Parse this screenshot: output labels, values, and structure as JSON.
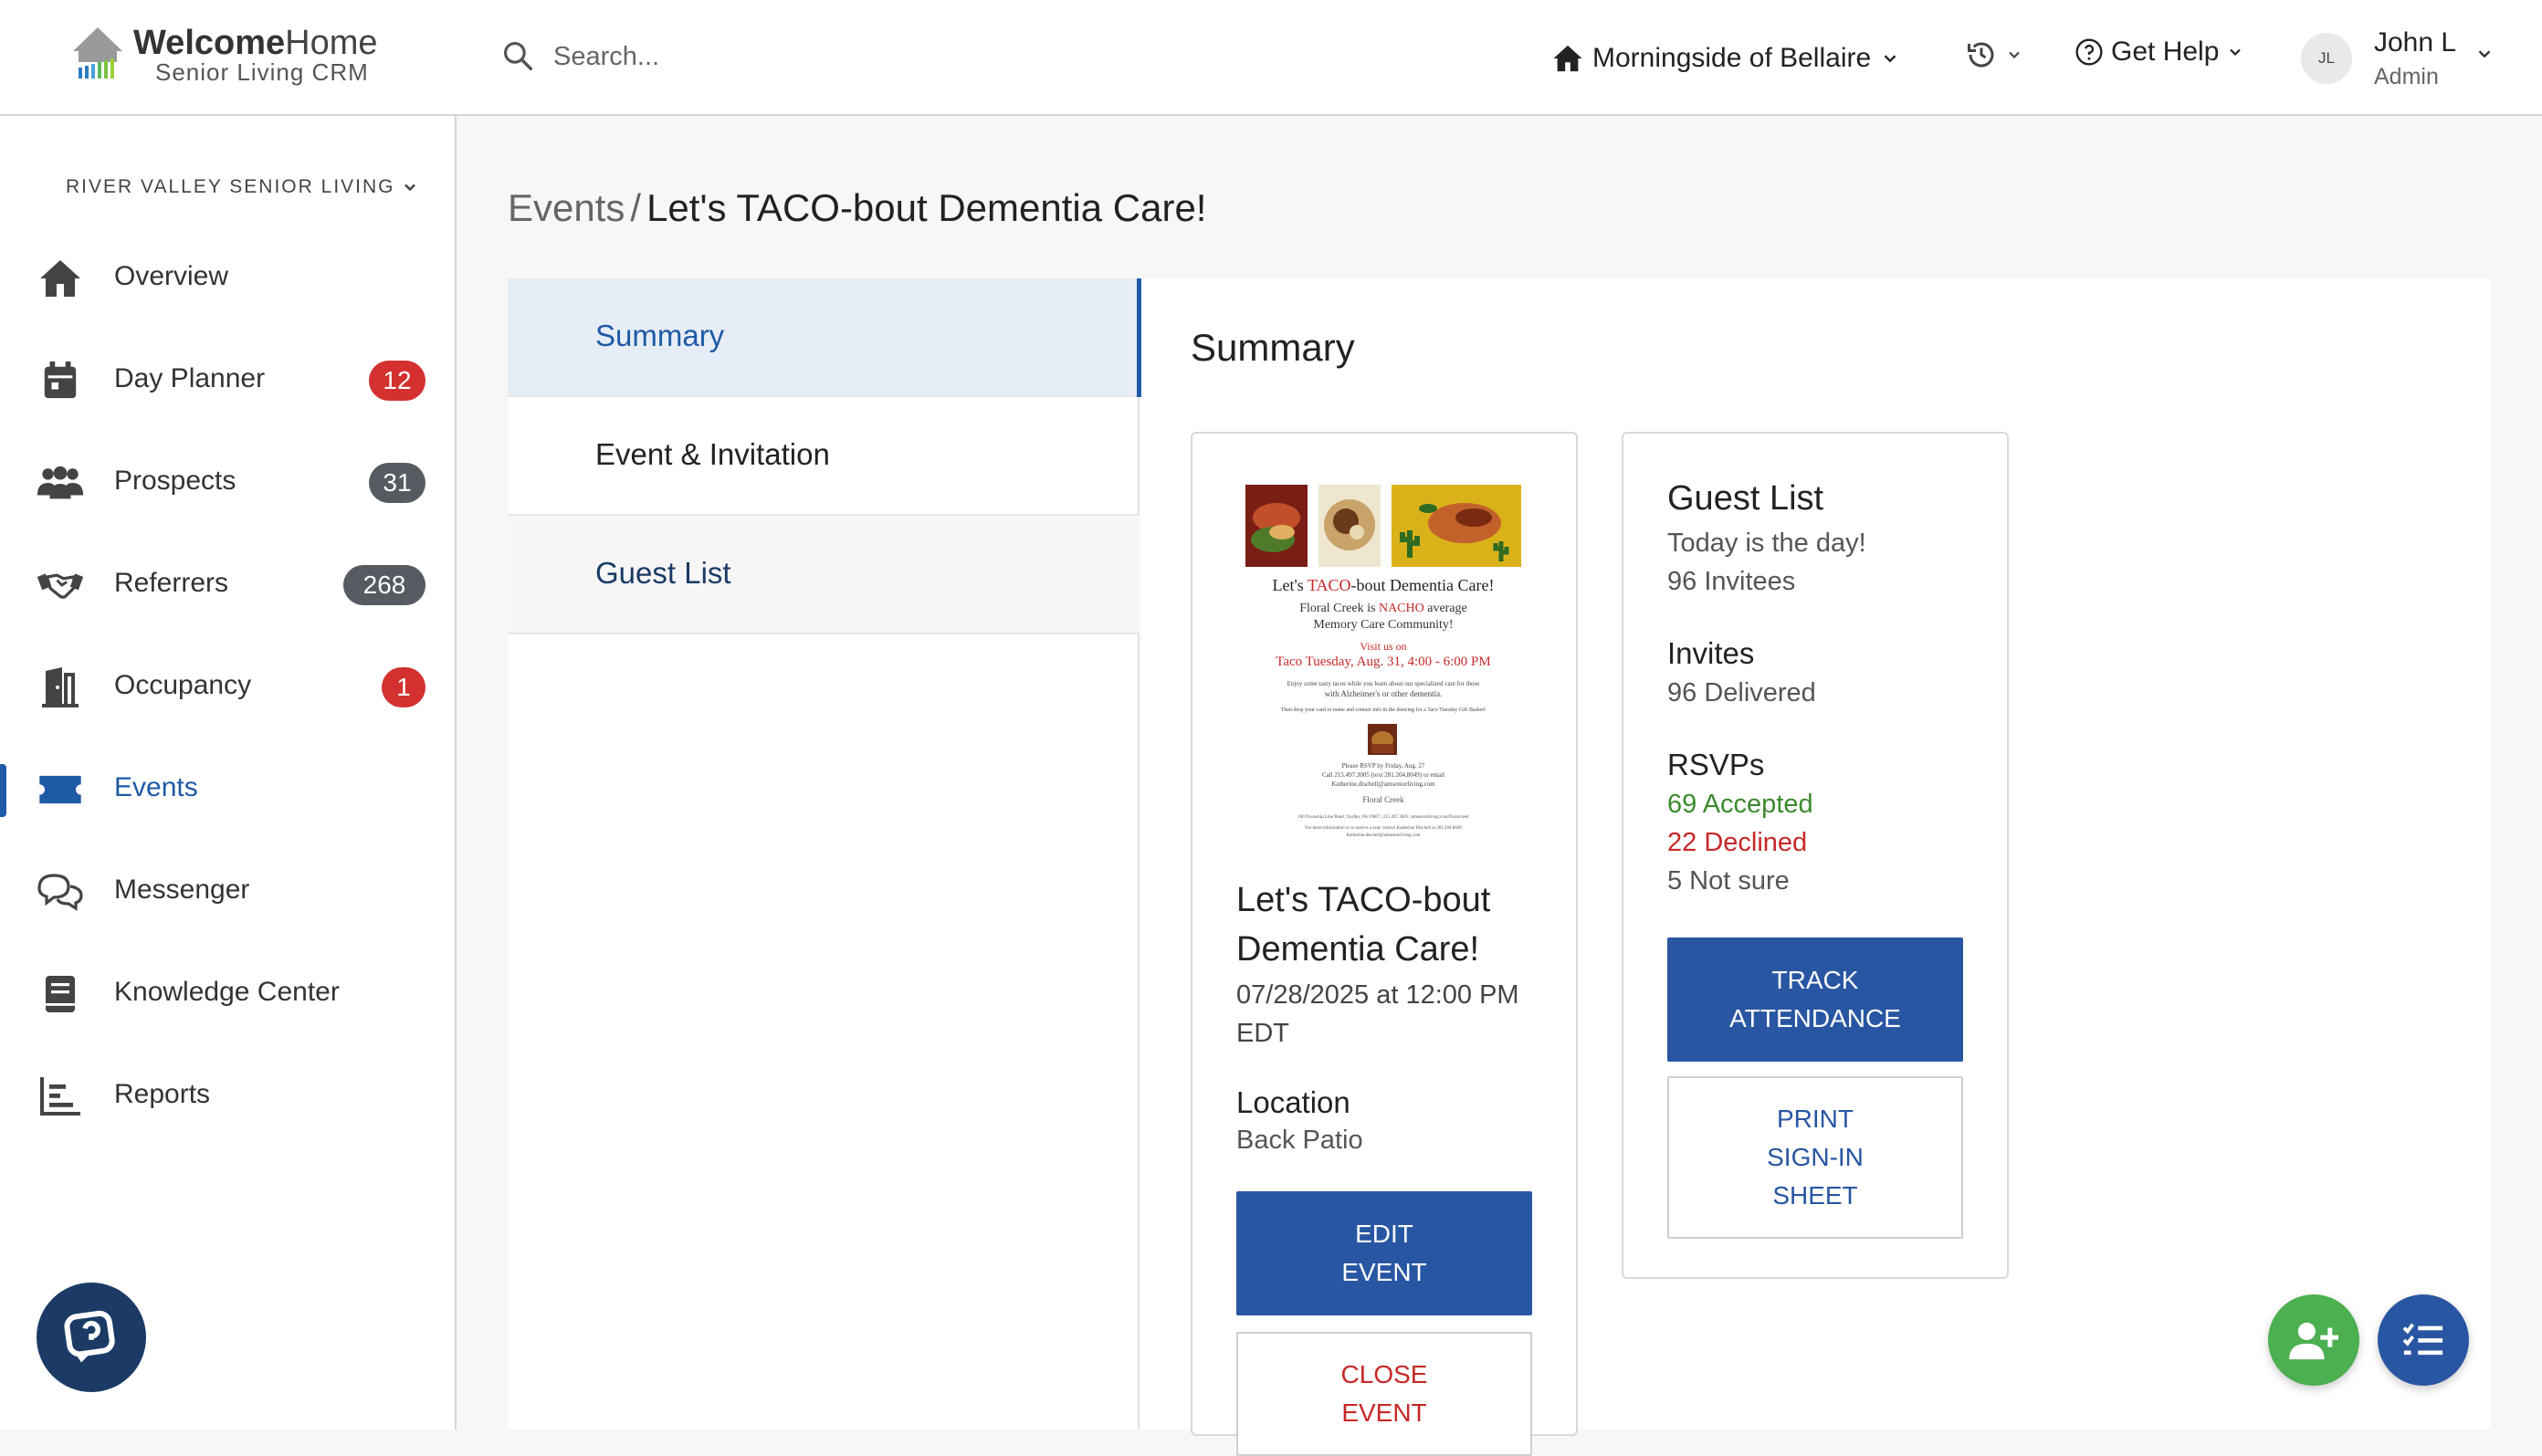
{
  "brand": {
    "title_bold": "Welcome",
    "title_rest": "Home",
    "subtitle": "Senior Living CRM"
  },
  "search": {
    "placeholder": "Search..."
  },
  "community": {
    "label": "Morningside of Bellaire"
  },
  "help": {
    "label": "Get Help"
  },
  "user": {
    "initials": "JL",
    "name": "John L",
    "role": "Admin"
  },
  "sidebar": {
    "org": "RIVER VALLEY SENIOR LIVING",
    "items": [
      {
        "label": "Overview",
        "icon": "home-icon"
      },
      {
        "label": "Day Planner",
        "icon": "calendar-icon",
        "badge": "12",
        "badge_color": "#d3302f"
      },
      {
        "label": "Prospects",
        "icon": "people-icon",
        "badge": "31",
        "badge_color": "#555b61"
      },
      {
        "label": "Referrers",
        "icon": "handshake-icon",
        "badge": "268",
        "badge_color": "#555b61"
      },
      {
        "label": "Occupancy",
        "icon": "door-icon",
        "badge": "1",
        "badge_color": "#d3302f"
      },
      {
        "label": "Events",
        "icon": "ticket-icon",
        "active": true
      },
      {
        "label": "Messenger",
        "icon": "chat-icon"
      },
      {
        "label": "Knowledge Center",
        "icon": "book-icon"
      },
      {
        "label": "Reports",
        "icon": "chart-icon"
      }
    ]
  },
  "breadcrumb": {
    "parent": "Events",
    "separator": "/",
    "current": "Let's TACO-bout Dementia Care!"
  },
  "tabs": [
    {
      "label": "Summary"
    },
    {
      "label": "Event & Invitation"
    },
    {
      "label": "Guest List"
    }
  ],
  "summary": {
    "title": "Summary",
    "flyer": {
      "headline_a": "Let's ",
      "headline_b": "TACO",
      "headline_c": "-bout Dementia Care!",
      "line1_a": "Floral Creek is ",
      "line1_b": "NACHO",
      "line1_c": " average",
      "line2": "Memory Care Community!",
      "line3": "Visit us on",
      "line4": "Taco Tuesday, Aug. 31, 4:00 - 6:00 PM",
      "line5": "Enjoy some tasty tacos while you learn about our specialized care for those",
      "line6": "with Alzheimer's or other dementia.",
      "line7": "Then drop your card or name and contact info in the drawing for a Taco Tuesday Gift Basket!",
      "line8": "Please RSVP by Friday, Aug. 27",
      "line9": "Call 215.497.3005 (text 281.204.8049) or email",
      "line10": "Katherine.dischell@amseniorliving.com",
      "line11": "Floral Creek",
      "line12": "100 Township Line Road, Yardley, PA 19067 | 215.497.3005 | amseniorliving.com/floralcreek",
      "line13": "For more information or to reserve a seat, contact Katherine Dischell at 281.204.8049",
      "line14": "Katherine.dischell@amseniorliving.com"
    },
    "event_name": "Let's TACO-bout Dementia Care!",
    "event_date": "07/28/2025 at 12:00 PM EDT",
    "location_heading": "Location",
    "location_value": "Back Patio",
    "edit_label": "EDIT EVENT",
    "close_label": "CLOSE EVENT",
    "guest_list": {
      "heading": "Guest List",
      "today": "Today is the day!",
      "invitees": "96 Invitees",
      "invites_heading": "Invites",
      "delivered": "96 Delivered",
      "rsvps_heading": "RSVPs",
      "accepted": "69 Accepted",
      "declined": "22 Declined",
      "not_sure": "5 Not sure",
      "track_label": "TRACK ATTENDANCE",
      "print_label": "PRINT SIGN-IN SHEET"
    }
  },
  "colors": {
    "accent": "#2856a2",
    "accepted": "#3c8a2e",
    "declined": "#c62828",
    "add_fab": "#4caf50"
  }
}
